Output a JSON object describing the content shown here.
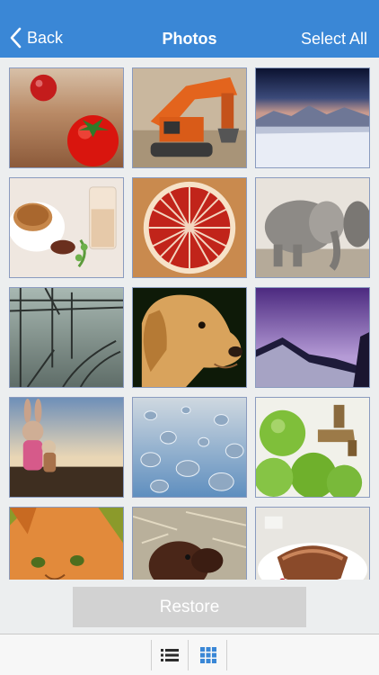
{
  "nav": {
    "back_label": "Back",
    "title": "Photos",
    "select_all_label": "Select All",
    "bar_color": "#3a87d6"
  },
  "photos": [
    {
      "name": "tomato-photo",
      "subject": "tomato and cherry on wood"
    },
    {
      "name": "excavator-photo",
      "subject": "orange excavator"
    },
    {
      "name": "snow-mountains-photo",
      "subject": "snowy mountains at dusk"
    },
    {
      "name": "coffee-photo",
      "subject": "coffee cup and milk glass"
    },
    {
      "name": "grapefruit-photo",
      "subject": "grapefruit slice"
    },
    {
      "name": "elephants-photo",
      "subject": "elephants"
    },
    {
      "name": "railway-photo",
      "subject": "railway tracks in fog"
    },
    {
      "name": "dog-photo",
      "subject": "labrador dog profile"
    },
    {
      "name": "purple-mountain-photo",
      "subject": "purple mountain sky"
    },
    {
      "name": "bunny-toys-photo",
      "subject": "bunny toys on railing"
    },
    {
      "name": "water-drops-photo",
      "subject": "water drops on glass"
    },
    {
      "name": "green-apples-photo",
      "subject": "green apples and tap"
    },
    {
      "name": "cat-photo",
      "subject": "ginger cat"
    },
    {
      "name": "calf-photo",
      "subject": "brown calf on straw"
    },
    {
      "name": "cake-photo",
      "subject": "cake on plate"
    }
  ],
  "restore": {
    "label": "Restore",
    "enabled": false
  },
  "tabbar": {
    "list_icon": "list-icon",
    "grid_icon": "grid-icon",
    "active": "grid",
    "active_color": "#3a87d6",
    "inactive_color": "#2c2c2c"
  }
}
